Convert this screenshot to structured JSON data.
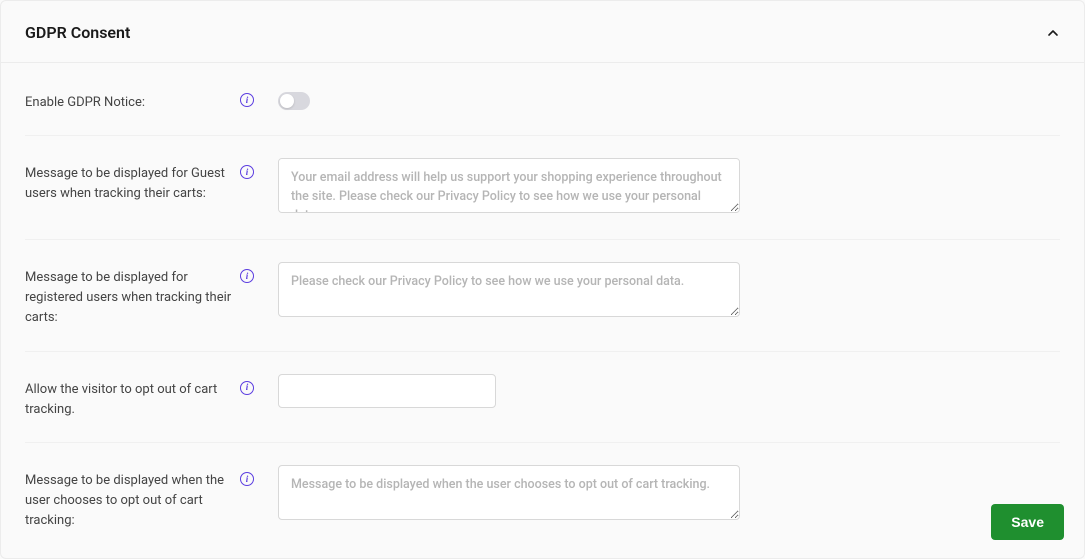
{
  "panel": {
    "title": "GDPR Consent"
  },
  "fields": {
    "enable_notice": {
      "label": "Enable GDPR Notice:"
    },
    "guest_message": {
      "label": "Message to be displayed for Guest users when tracking their carts:",
      "placeholder": "Your email address will help us support your shopping experience throughout the site. Please check our Privacy Policy to see how we use your personal data.",
      "value": ""
    },
    "registered_message": {
      "label": "Message to be displayed for registered users when tracking their carts:",
      "placeholder": "Please check our Privacy Policy to see how we use your personal data.",
      "value": ""
    },
    "opt_out_allow": {
      "label": "Allow the visitor to opt out of cart tracking.",
      "value": ""
    },
    "opt_out_message": {
      "label": "Message to be displayed when the user chooses to opt out of cart tracking:",
      "placeholder": "Message to be displayed when the user chooses to opt out of cart tracking.",
      "value": ""
    }
  },
  "buttons": {
    "save": "Save"
  }
}
